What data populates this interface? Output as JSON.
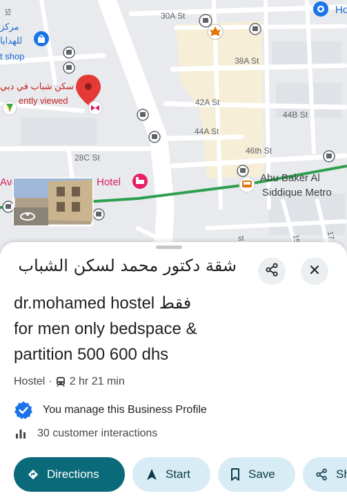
{
  "map": {
    "streets": [
      "30A St",
      "38A St",
      "42A St",
      "44A St",
      "44B St",
      "46th St",
      "28C St",
      "15A",
      "17",
      "st"
    ],
    "poi_hotel_label": "Hotel",
    "poi_abu_baker_line1": "Abu Baker Al",
    "poi_abu_baker_line2": "Siddique Metro",
    "top_right_label": "Ho",
    "left_arabic_1": "مركز",
    "left_arabic_2": "للهدايا",
    "left_shop": "t shop",
    "pin_arabic_label": "سكن شباب في دبي",
    "pin_recently_viewed": "ently viewed",
    "left_fragment": "Ava",
    "top_left_fragment": "St"
  },
  "place": {
    "title_arabic": "شقة دكتور محمد لسكن الشباب",
    "title_lines": [
      "dr.mohamed hostel فقط",
      "for men only bedspace &",
      "partition 500 600 dhs"
    ],
    "category": "Hostel",
    "separator": "·",
    "transit_time": "2 hr 21 min",
    "manage_text": "You manage this Business Profile",
    "interactions_text": "30 customer interactions"
  },
  "actions": {
    "directions": "Directions",
    "start": "Start",
    "save": "Save",
    "share": "Sh"
  },
  "colors": {
    "accent": "#0b6a7a",
    "chip_secondary": "#d7ecf5",
    "pin_red": "#e53935",
    "verified_blue": "#1a73e8",
    "transit_line": "#2e9e4f",
    "hotel_pink": "#e91e63"
  }
}
